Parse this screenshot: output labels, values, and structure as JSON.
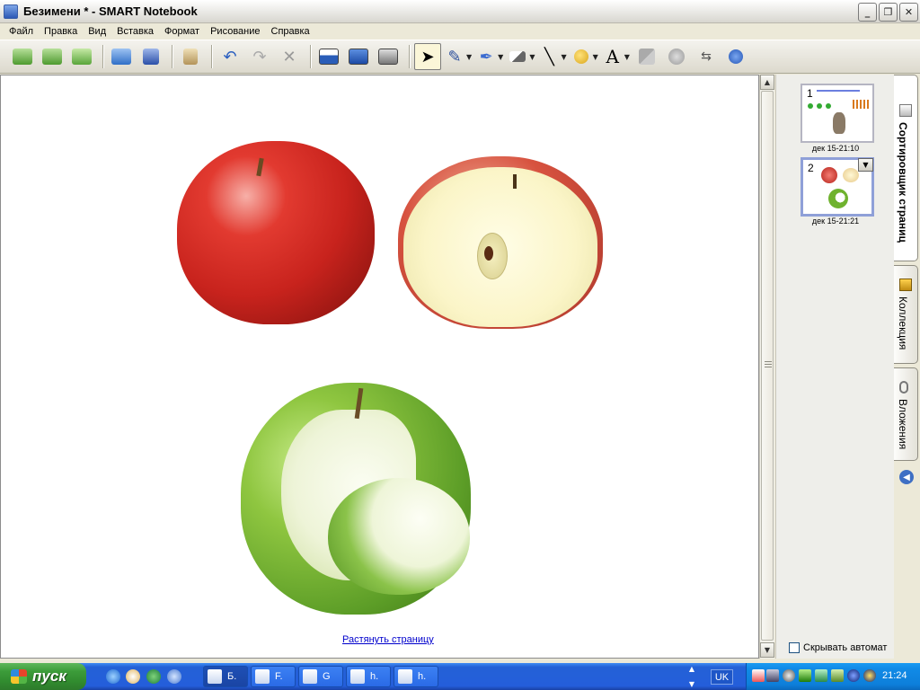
{
  "window": {
    "title": "Безимени * - SMART Notebook"
  },
  "menu": [
    "Файл",
    "Правка",
    "Вид",
    "Вставка",
    "Формат",
    "Рисование",
    "Справка"
  ],
  "toolbar": {
    "icons": [
      "back-icon",
      "forward-icon",
      "add-page-icon",
      "open-icon",
      "save-icon",
      "paste-icon",
      "undo-icon",
      "redo-icon",
      "delete-icon",
      "screen-shade-icon",
      "full-screen-icon",
      "capture-icon",
      "select-icon",
      "pen-icon",
      "creative-pen-icon",
      "eraser-icon",
      "line-icon",
      "shape-icon",
      "text-icon",
      "fill-icon",
      "properties-icon",
      "move-toolbar-icon",
      "more-icon"
    ]
  },
  "canvas": {
    "stretch_link": "Растянуть страницу"
  },
  "sorter": {
    "pages": [
      {
        "number": "1",
        "caption": "дек 15-21:10"
      },
      {
        "number": "2",
        "caption": "дек 15-21:21"
      }
    ],
    "autohide_label": "Скрывать автомат"
  },
  "tabs": {
    "sorter": "Сортировщик страниц",
    "gallery": "Коллекция",
    "attachments": "Вложения"
  },
  "taskbar": {
    "start_label": "пуск",
    "tasks": [
      "Б.",
      "F.",
      "G",
      "h.",
      "h."
    ],
    "language": "UK",
    "clock": "21:24"
  },
  "colors": {
    "accent": "#245edb",
    "start": "#3c9c3a",
    "link": "#0000cc"
  }
}
